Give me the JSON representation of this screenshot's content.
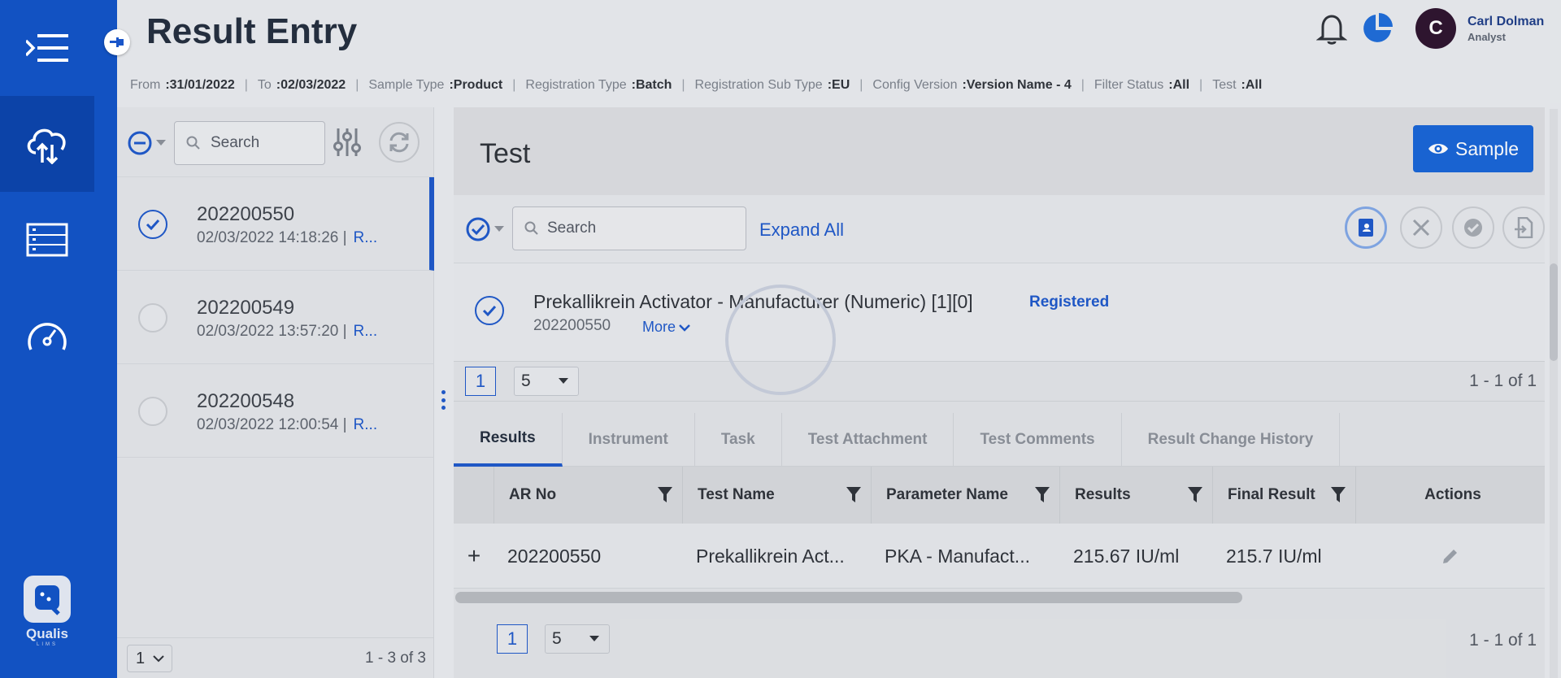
{
  "header": {
    "title": "Result Entry",
    "user": {
      "initial": "C",
      "name": "Carl Dolman",
      "role": "Analyst"
    }
  },
  "filters": [
    {
      "label": "From",
      "value": ":31/01/2022"
    },
    {
      "label": "To",
      "value": ":02/03/2022"
    },
    {
      "label": "Sample Type",
      "value": ":Product"
    },
    {
      "label": "Registration Type",
      "value": ":Batch"
    },
    {
      "label": "Registration Sub Type",
      "value": ":EU"
    },
    {
      "label": "Config Version",
      "value": ":Version Name - 4"
    },
    {
      "label": "Filter Status",
      "value": ":All"
    },
    {
      "label": "Test",
      "value": ":All"
    }
  ],
  "logo": {
    "brand": "Qualis",
    "sub": "LIMS"
  },
  "sample_list": {
    "search_placeholder": "Search",
    "items": [
      {
        "id": "202200550",
        "datetime": "02/03/2022 14:18:26 |",
        "suffix": "R...",
        "checked": true
      },
      {
        "id": "202200549",
        "datetime": "02/03/2022 13:57:20 |",
        "suffix": "R...",
        "checked": false
      },
      {
        "id": "202200548",
        "datetime": "02/03/2022 12:00:54 |",
        "suffix": "R...",
        "checked": false
      }
    ],
    "page": "1",
    "count": "1 - 3 of 3"
  },
  "test_panel": {
    "title": "Test",
    "sample_button": "Sample",
    "search_placeholder": "Search",
    "expand_all": "Expand All",
    "test": {
      "name": "Prekallikrein Activator - Manufacturer (Numeric) [1][0]",
      "status": "Registered",
      "ar": "202200550",
      "more": "More"
    },
    "pager": {
      "page": "1",
      "size": "5",
      "count": "1 - 1 of 1"
    }
  },
  "tabs": [
    "Results",
    "Instrument",
    "Task",
    "Test Attachment",
    "Test Comments",
    "Result Change History"
  ],
  "grid": {
    "columns": [
      "AR No",
      "Test Name",
      "Parameter Name",
      "Results",
      "Final Result",
      "Actions"
    ],
    "rows": [
      {
        "expand": "+",
        "ar_no": "202200550",
        "test_name": "Prekallikrein Act...",
        "parameter": "PKA - Manufact...",
        "result": "215.67 IU/ml",
        "final": "215.7 IU/ml"
      }
    ],
    "pager": {
      "page": "1",
      "size": "5",
      "count": "1 - 1 of 1"
    }
  },
  "colors": {
    "nav": "#1252c2",
    "accent": "#1a56c9",
    "primary_button": "#1462d6"
  },
  "icons": [
    "menu-icon",
    "cloud-sync-icon",
    "list-icon",
    "dashboard-gauge-icon",
    "bell-icon",
    "pie-chart-icon",
    "eye-icon",
    "search-icon",
    "filter-icon",
    "refresh-icon",
    "edit-icon"
  ]
}
